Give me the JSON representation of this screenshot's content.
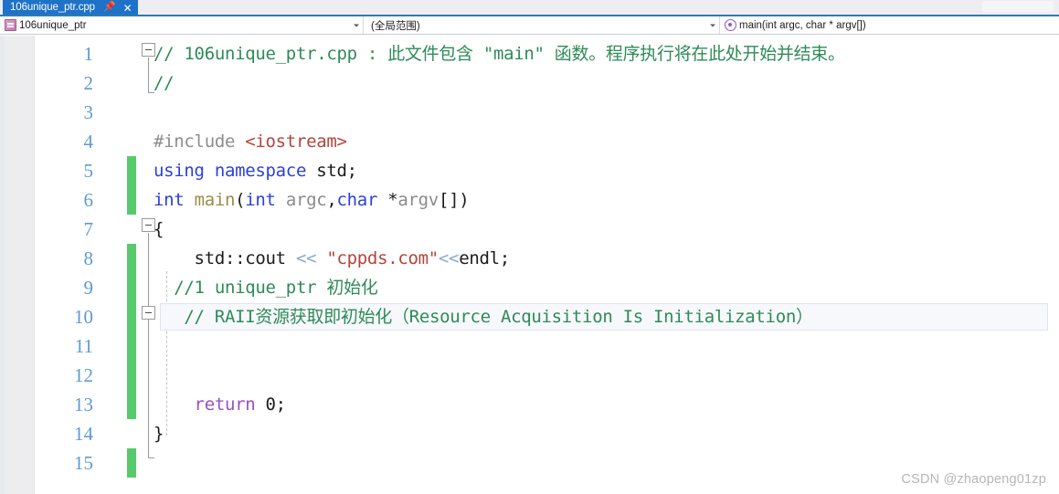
{
  "window": {
    "tab": {
      "title": "106unique_ptr.cpp",
      "pin_icon": "pin-icon",
      "close_icon": "close-icon"
    }
  },
  "navbar": {
    "project": {
      "icon": "cpp-file-icon",
      "label": "106unique_ptr"
    },
    "scope": {
      "label": "(全局范围)"
    },
    "function": {
      "icon": "method-icon",
      "label": "main(int argc, char * argv[])"
    }
  },
  "editor": {
    "current_line": 10,
    "change_bar_lines": [
      5,
      6,
      8,
      9,
      10,
      11,
      12,
      13,
      15
    ],
    "lines": [
      {
        "number": "1",
        "tokens": [
          {
            "text": "// 106unique_ptr.cpp : 此文件包含 \"main\" 函数。程序执行将在此处开始并结束。",
            "cls": "t-comment"
          }
        ]
      },
      {
        "number": "2",
        "tokens": [
          {
            "text": "//",
            "cls": "t-comment"
          }
        ]
      },
      {
        "number": "3",
        "tokens": []
      },
      {
        "number": "4",
        "tokens": [
          {
            "text": "#include ",
            "cls": "t-pp"
          },
          {
            "text": "<iostream>",
            "cls": "t-inc"
          }
        ]
      },
      {
        "number": "5",
        "tokens": [
          {
            "text": "using namespace ",
            "cls": "t-kw"
          },
          {
            "text": "std;",
            "cls": "t-plain"
          }
        ]
      },
      {
        "number": "6",
        "tokens": [
          {
            "text": "int ",
            "cls": "t-kw"
          },
          {
            "text": "main",
            "cls": "t-func"
          },
          {
            "text": "(",
            "cls": "t-punc"
          },
          {
            "text": "int ",
            "cls": "t-kw"
          },
          {
            "text": "argc",
            "cls": "t-ident"
          },
          {
            "text": ",",
            "cls": "t-punc"
          },
          {
            "text": "char ",
            "cls": "t-kw"
          },
          {
            "text": "*",
            "cls": "t-punc"
          },
          {
            "text": "argv",
            "cls": "t-ident"
          },
          {
            "text": "[])",
            "cls": "t-punc"
          }
        ]
      },
      {
        "number": "7",
        "tokens": [
          {
            "text": "{",
            "cls": "t-punc"
          }
        ]
      },
      {
        "number": "8",
        "tokens": [
          {
            "text": "    std::cout ",
            "cls": "t-plain"
          },
          {
            "text": "<< ",
            "cls": "t-op"
          },
          {
            "text": "\"cppds.com\"",
            "cls": "t-str"
          },
          {
            "text": "<<",
            "cls": "t-op"
          },
          {
            "text": "endl;",
            "cls": "t-plain"
          }
        ]
      },
      {
        "number": "9",
        "tokens": [
          {
            "text": "  //1 unique_ptr 初始化",
            "cls": "t-comment"
          }
        ]
      },
      {
        "number": "10",
        "tokens": [
          {
            "text": "   // RAII资源获取即初始化（Resource Acquisition Is Initialization）",
            "cls": "t-comment"
          }
        ]
      },
      {
        "number": "11",
        "tokens": []
      },
      {
        "number": "12",
        "tokens": []
      },
      {
        "number": "13",
        "tokens": [
          {
            "text": "    return ",
            "cls": "t-ret"
          },
          {
            "text": "0;",
            "cls": "t-num"
          }
        ]
      },
      {
        "number": "14",
        "tokens": [
          {
            "text": "}",
            "cls": "t-punc"
          }
        ]
      },
      {
        "number": "15",
        "tokens": []
      }
    ]
  },
  "watermark": {
    "text": "CSDN @zhaopeng01zp"
  }
}
